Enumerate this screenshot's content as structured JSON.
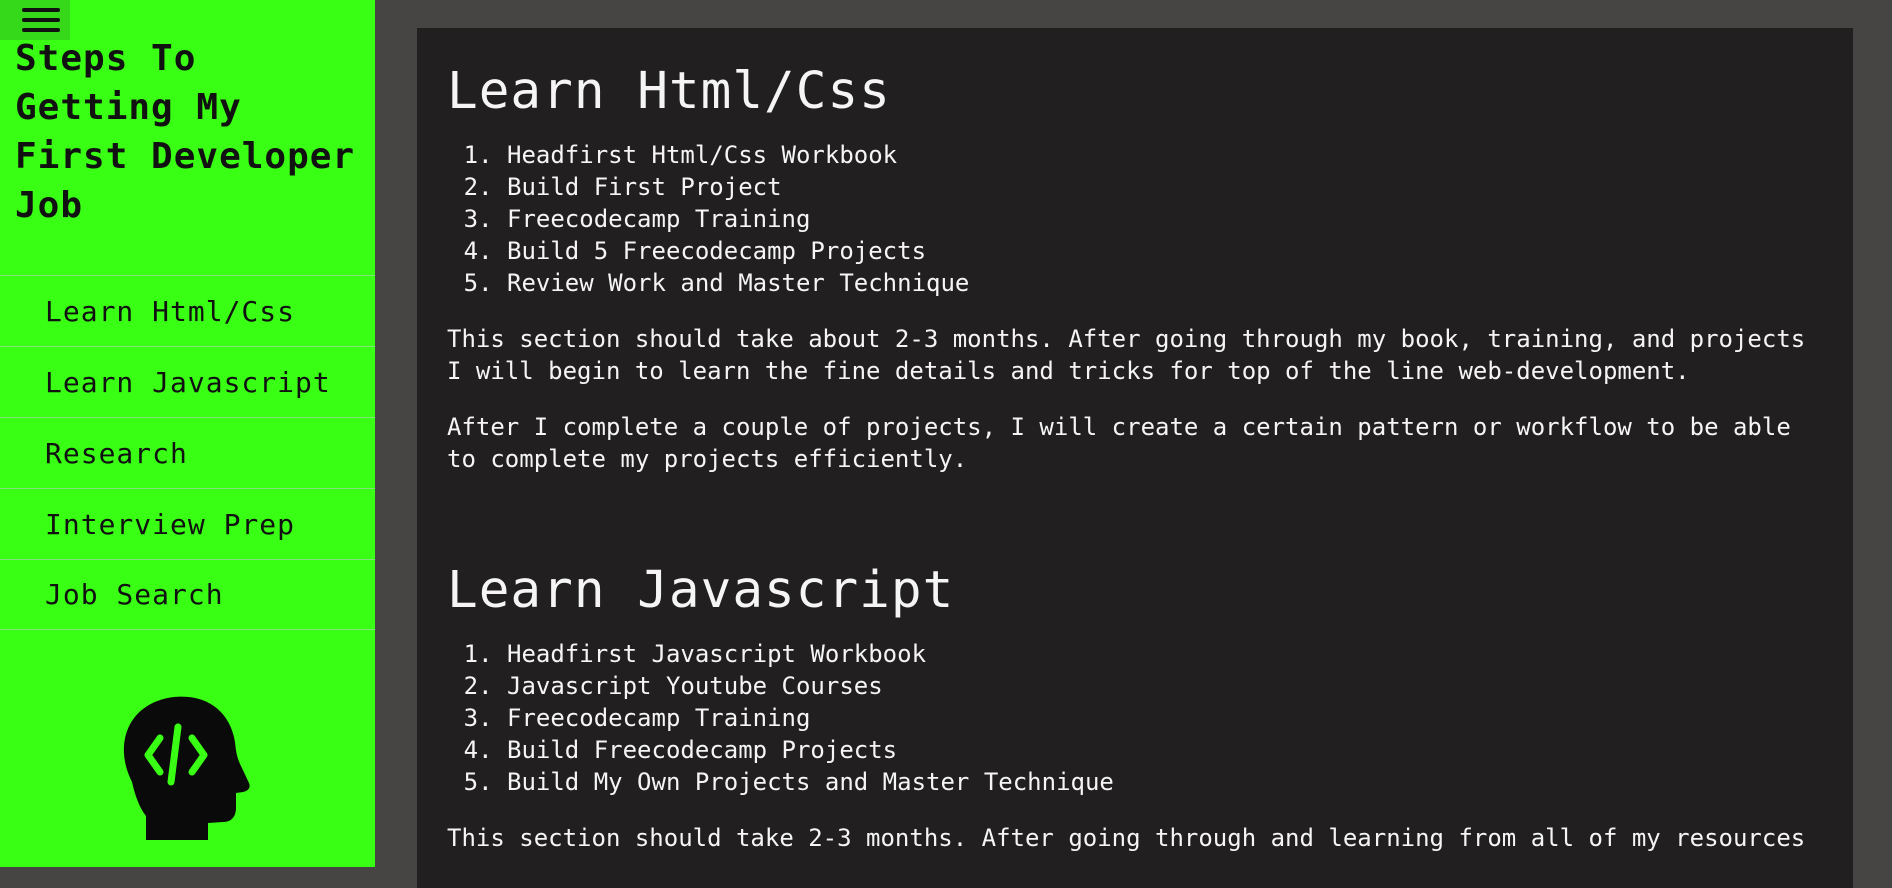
{
  "sidebar": {
    "title": "Steps To Getting My First Developer Job",
    "nav": [
      {
        "label": "Learn Html/Css"
      },
      {
        "label": "Learn Javascript"
      },
      {
        "label": "Research"
      },
      {
        "label": "Interview Prep"
      },
      {
        "label": "Job Search"
      }
    ],
    "menu_icon": "hamburger-menu-icon",
    "logo_icon": "developer-head-icon"
  },
  "sections": [
    {
      "heading": "Learn Html/Css",
      "steps": [
        "Headfirst Html/Css Workbook",
        "Build First Project",
        "Freecodecamp Training",
        "Build 5 Freecodecamp Projects",
        "Review Work and Master Technique"
      ],
      "paragraphs": [
        "This section should take about 2-3 months. After going through my book, training, and projects I will begin to learn the fine details and tricks for top of the line web-development.",
        "After I complete a couple of projects, I will create a certain pattern or workflow to be able to complete my projects efficiently."
      ]
    },
    {
      "heading": "Learn Javascript",
      "steps": [
        "Headfirst Javascript Workbook",
        "Javascript Youtube Courses",
        "Freecodecamp Training",
        "Build Freecodecamp Projects",
        "Build My Own Projects and Master Technique"
      ],
      "paragraphs": [
        "This section should take 2-3 months. After going through and learning from all of my resources"
      ]
    }
  ],
  "colors": {
    "sidebar_bg": "#39ff14",
    "main_bg": "#211f20",
    "page_bg": "#474444",
    "text_light": "#f5f5f5"
  }
}
